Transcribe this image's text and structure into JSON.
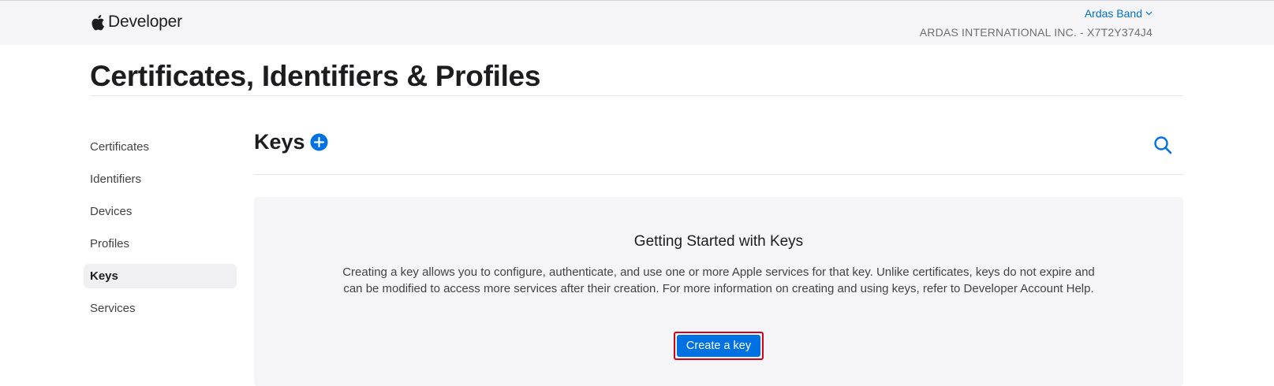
{
  "header": {
    "brand": "Developer",
    "account_name": "Ardas Band",
    "team": "ARDAS INTERNATIONAL INC. - X7T2Y374J4"
  },
  "page": {
    "title": "Certificates, Identifiers & Profiles"
  },
  "sidebar": {
    "items": [
      {
        "label": "Certificates"
      },
      {
        "label": "Identifiers"
      },
      {
        "label": "Devices"
      },
      {
        "label": "Profiles"
      },
      {
        "label": "Keys"
      },
      {
        "label": "Services"
      }
    ],
    "active": "Keys"
  },
  "section": {
    "title": "Keys",
    "add_icon": "plus-circle-icon",
    "search_icon": "search-icon"
  },
  "empty_state": {
    "title": "Getting Started with Keys",
    "body": "Creating a key allows you to configure, authenticate, and use one or more Apple services for that key. Unlike certificates, keys do not expire and can be modified to access more services after their creation. For more information on creating and using keys, refer to Developer Account Help.",
    "button": "Create a key"
  },
  "colors": {
    "accent": "#0071e3",
    "link": "#0070c9",
    "highlight_border": "#d0021b",
    "header_bg": "#f5f5f7"
  }
}
